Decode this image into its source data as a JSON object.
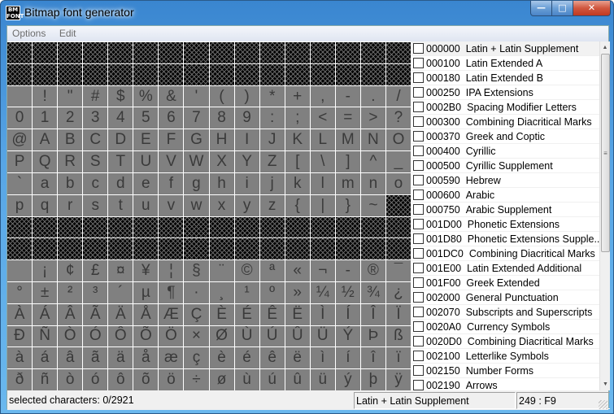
{
  "window": {
    "title": "Bitmap font generator",
    "icon_text": "BM FONT"
  },
  "menu": {
    "items": [
      "Options",
      "Edit"
    ]
  },
  "grid": {
    "rows": [
      [
        null,
        null,
        null,
        null,
        null,
        null,
        null,
        null,
        null,
        null,
        null,
        null,
        null,
        null,
        null,
        null
      ],
      [
        null,
        null,
        null,
        null,
        null,
        null,
        null,
        null,
        null,
        null,
        null,
        null,
        null,
        null,
        null,
        null
      ],
      [
        " ",
        "!",
        "\"",
        "#",
        "$",
        "%",
        "&",
        "'",
        "(",
        ")",
        "*",
        "+",
        ",",
        "-",
        ".",
        "/"
      ],
      [
        "0",
        "1",
        "2",
        "3",
        "4",
        "5",
        "6",
        "7",
        "8",
        "9",
        ":",
        ";",
        "<",
        "=",
        ">",
        "?"
      ],
      [
        "@",
        "A",
        "B",
        "C",
        "D",
        "E",
        "F",
        "G",
        "H",
        "I",
        "J",
        "K",
        "L",
        "M",
        "N",
        "O"
      ],
      [
        "P",
        "Q",
        "R",
        "S",
        "T",
        "U",
        "V",
        "W",
        "X",
        "Y",
        "Z",
        "[",
        "\\",
        "]",
        "^",
        "_"
      ],
      [
        "`",
        "a",
        "b",
        "c",
        "d",
        "e",
        "f",
        "g",
        "h",
        "i",
        "j",
        "k",
        "l",
        "m",
        "n",
        "o"
      ],
      [
        "p",
        "q",
        "r",
        "s",
        "t",
        "u",
        "v",
        "w",
        "x",
        "y",
        "z",
        "{",
        "|",
        "}",
        "~",
        null
      ],
      [
        null,
        null,
        null,
        null,
        null,
        null,
        null,
        null,
        null,
        null,
        null,
        null,
        null,
        null,
        null,
        null
      ],
      [
        null,
        null,
        null,
        null,
        null,
        null,
        null,
        null,
        null,
        null,
        null,
        null,
        null,
        null,
        null,
        null
      ],
      [
        " ",
        "¡",
        "¢",
        "£",
        "¤",
        "¥",
        "¦",
        "§",
        "¨",
        "©",
        "ª",
        "«",
        "¬",
        "-",
        "®",
        "¯"
      ],
      [
        "°",
        "±",
        "²",
        "³",
        "´",
        "µ",
        "¶",
        "·",
        "¸",
        "¹",
        "º",
        "»",
        "¼",
        "½",
        "¾",
        "¿"
      ],
      [
        "À",
        "Á",
        "Â",
        "Ã",
        "Ä",
        "Å",
        "Æ",
        "Ç",
        "È",
        "É",
        "Ê",
        "Ë",
        "Ì",
        "Í",
        "Î",
        "Ï"
      ],
      [
        "Ð",
        "Ñ",
        "Ò",
        "Ó",
        "Ô",
        "Õ",
        "Ö",
        "×",
        "Ø",
        "Ù",
        "Ú",
        "Û",
        "Ü",
        "Ý",
        "Þ",
        "ß"
      ],
      [
        "à",
        "á",
        "â",
        "ã",
        "ä",
        "å",
        "æ",
        "ç",
        "è",
        "é",
        "ê",
        "ë",
        "ì",
        "í",
        "î",
        "ï"
      ],
      [
        "ð",
        "ñ",
        "ò",
        "ó",
        "ô",
        "õ",
        "ö",
        "÷",
        "ø",
        "ù",
        "ú",
        "û",
        "ü",
        "ý",
        "þ",
        "ÿ"
      ]
    ]
  },
  "subsets": [
    {
      "code": "000000",
      "name": "Latin + Latin Supplement",
      "checked": false
    },
    {
      "code": "000100",
      "name": "Latin Extended A",
      "checked": false
    },
    {
      "code": "000180",
      "name": "Latin Extended B",
      "checked": false
    },
    {
      "code": "000250",
      "name": "IPA Extensions",
      "checked": false
    },
    {
      "code": "0002B0",
      "name": "Spacing Modifier Letters",
      "checked": false
    },
    {
      "code": "000300",
      "name": "Combining Diacritical Marks",
      "checked": false
    },
    {
      "code": "000370",
      "name": "Greek and Coptic",
      "checked": false
    },
    {
      "code": "000400",
      "name": "Cyrillic",
      "checked": false
    },
    {
      "code": "000500",
      "name": "Cyrillic Supplement",
      "checked": false
    },
    {
      "code": "000590",
      "name": "Hebrew",
      "checked": false
    },
    {
      "code": "000600",
      "name": "Arabic",
      "checked": false
    },
    {
      "code": "000750",
      "name": "Arabic Supplement",
      "checked": false
    },
    {
      "code": "001D00",
      "name": "Phonetic Extensions",
      "checked": false
    },
    {
      "code": "001D80",
      "name": "Phonetic Extensions Supple...",
      "checked": false
    },
    {
      "code": "001DC0",
      "name": "Combining Diacritical Marks",
      "checked": false
    },
    {
      "code": "001E00",
      "name": "Latin Extended Additional",
      "checked": false
    },
    {
      "code": "001F00",
      "name": "Greek Extended",
      "checked": false
    },
    {
      "code": "002000",
      "name": "General Punctuation",
      "checked": false
    },
    {
      "code": "002070",
      "name": "Subscripts and Superscripts",
      "checked": false
    },
    {
      "code": "0020A0",
      "name": "Currency Symbols",
      "checked": false
    },
    {
      "code": "0020D0",
      "name": "Combining Diacritical Marks",
      "checked": false
    },
    {
      "code": "002100",
      "name": "Letterlike Symbols",
      "checked": false
    },
    {
      "code": "002150",
      "name": "Number Forms",
      "checked": false
    },
    {
      "code": "002190",
      "name": "Arrows",
      "checked": false
    }
  ],
  "status": {
    "selected": "selected characters: 0/2921",
    "subset": "Latin + Latin Supplement",
    "char": "249 : F9"
  }
}
